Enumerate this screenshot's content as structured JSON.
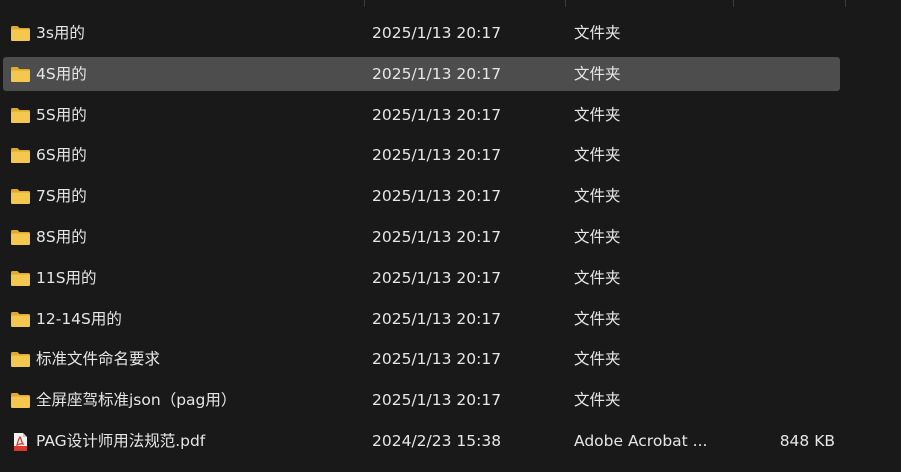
{
  "files": [
    {
      "name": "3s用的",
      "date": "2025/1/13 20:17",
      "type": "文件夹",
      "size": "",
      "icon": "folder-icon",
      "selected": false
    },
    {
      "name": "4S用的",
      "date": "2025/1/13 20:17",
      "type": "文件夹",
      "size": "",
      "icon": "folder-icon",
      "selected": true
    },
    {
      "name": "5S用的",
      "date": "2025/1/13 20:17",
      "type": "文件夹",
      "size": "",
      "icon": "folder-icon",
      "selected": false
    },
    {
      "name": "6S用的",
      "date": "2025/1/13 20:17",
      "type": "文件夹",
      "size": "",
      "icon": "folder-icon",
      "selected": false
    },
    {
      "name": "7S用的",
      "date": "2025/1/13 20:17",
      "type": "文件夹",
      "size": "",
      "icon": "folder-icon",
      "selected": false
    },
    {
      "name": "8S用的",
      "date": "2025/1/13 20:17",
      "type": "文件夹",
      "size": "",
      "icon": "folder-icon",
      "selected": false
    },
    {
      "name": "11S用的",
      "date": "2025/1/13 20:17",
      "type": "文件夹",
      "size": "",
      "icon": "folder-icon",
      "selected": false
    },
    {
      "name": "12-14S用的",
      "date": "2025/1/13 20:17",
      "type": "文件夹",
      "size": "",
      "icon": "folder-icon",
      "selected": false
    },
    {
      "name": "标准文件命名要求",
      "date": "2025/1/13 20:17",
      "type": "文件夹",
      "size": "",
      "icon": "folder-icon",
      "selected": false
    },
    {
      "name": "全屏座驾标准json（pag用）",
      "date": "2025/1/13 20:17",
      "type": "文件夹",
      "size": "",
      "icon": "folder-icon",
      "selected": false
    },
    {
      "name": "PAG设计师用法规范.pdf",
      "date": "2024/2/23 15:38",
      "type": "Adobe Acrobat ...",
      "size": "848 KB",
      "icon": "pdf-file-icon",
      "selected": false
    }
  ],
  "colors": {
    "background": "#191919",
    "selected_row": "#4d4d4d",
    "folder": "#f4c74f",
    "folder_dark": "#e0a92c",
    "pdf_red": "#d93a2b"
  }
}
